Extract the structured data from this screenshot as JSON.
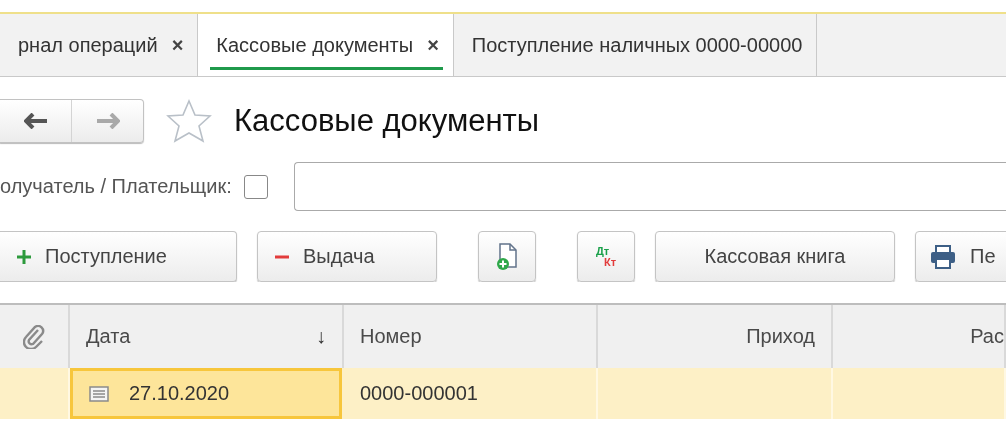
{
  "tabs": [
    {
      "label": "рнал операций",
      "close": "×",
      "selected": false
    },
    {
      "label": "Кассовые документы",
      "close": "×",
      "selected": true
    },
    {
      "label": "Поступление наличных 0000-00000",
      "selected": false
    }
  ],
  "navigation": {
    "back": {
      "disabled": false
    },
    "forward": {
      "disabled": true
    }
  },
  "favorite": false,
  "title": "Кассовые документы",
  "filter": {
    "label": "олучатель / Плательщик:",
    "checked": false
  },
  "toolbar": [
    {
      "kind": "plus",
      "label": "Поступление"
    },
    {
      "kind": "minus",
      "label": "Выдача"
    },
    {
      "kind": "new-document"
    },
    {
      "kind": "dt-kt",
      "debit": "Дт",
      "credit": "Кт"
    },
    {
      "kind": "text",
      "label": "Кассовая книга"
    },
    {
      "kind": "print",
      "label": "Пе"
    }
  ],
  "table": {
    "columns": [
      {
        "kind": "attachment"
      },
      {
        "kind": "date",
        "label": "Дата",
        "sort": "↓"
      },
      {
        "kind": "text",
        "label": "Номер"
      },
      {
        "kind": "number",
        "label": "Приход"
      },
      {
        "kind": "number",
        "label": "Рас"
      }
    ],
    "rows": [
      {
        "selected": true,
        "cells": [
          {
            "focused": false
          },
          {
            "text": "27.10.2020",
            "focused": true
          },
          {
            "text": "0000-000001",
            "focused": false
          },
          {
            "focused": false
          },
          {
            "focused": false
          }
        ]
      }
    ]
  }
}
